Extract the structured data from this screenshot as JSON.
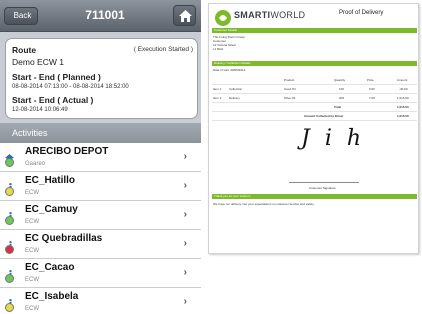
{
  "navbar": {
    "back_label": "Back",
    "title": "711001"
  },
  "route": {
    "label": "Route",
    "status": "( Execution Started )",
    "name": "Demo ECW 1",
    "planned_label": "Start - End ( Planned )",
    "planned_value": "08-08-2014 07:13:00 - 08-08-2014 18:52:00",
    "actual_label": "Start - End ( Actual )",
    "actual_value": "12-08-2014 10:06:49"
  },
  "activities": {
    "header": "Activities",
    "items": [
      {
        "title": "ARECIBO DEPOT",
        "subtitle": "Gaareo",
        "icon": "home-icon",
        "dot_color": "#69c95a"
      },
      {
        "title": "EC_Hatillo",
        "subtitle": "ECW",
        "icon": "person-icon",
        "dot_color": "#e8d84a"
      },
      {
        "title": "EC_Camuy",
        "subtitle": "ECW",
        "icon": "person-icon",
        "dot_color": "#69c95a"
      },
      {
        "title": "EC Quebradillas",
        "subtitle": "ECW",
        "icon": "person-icon",
        "dot_color": "#d9323a"
      },
      {
        "title": "EC_Cacao",
        "subtitle": "ECW",
        "icon": "person-icon",
        "dot_color": "#69c95a"
      },
      {
        "title": "EC_Isabela",
        "subtitle": "ECW",
        "icon": "person-icon",
        "dot_color": "#e8d84a"
      }
    ]
  },
  "document": {
    "brand_bold": "SMARTI",
    "brand_light": "WORLD",
    "title": "Proof of Delivery",
    "customer_details_label": "Customer Details",
    "customer_lines": [
      "The Living Room Group",
      "Customer",
      "10 Victoria Street",
      "LJ 8GG"
    ],
    "delivery_label": "Delivery / Collection Details",
    "date_line": "Date of visit: 20/06/2014",
    "table_headers": [
      "Product",
      "Quantity",
      "Price",
      "Amount"
    ],
    "rows": [
      [
        "Item 1",
        "Collection",
        "Used Oil",
        "100",
        "0.00",
        "-40.00"
      ],
      [
        "Item 1",
        "Delivery",
        "Olive Oil",
        "200",
        "7.00",
        "1,015.00"
      ]
    ],
    "total_label": "Total",
    "total_value": "1,015.00",
    "collected_label": "Amount Collected by Driver",
    "collected_value": "1,015.00",
    "signature_text": "J i h",
    "signature_caption": "Customer Signature",
    "thanks_label": "Thank you for your custom !",
    "thanks_line": "We hope our delivery met your expectations on customer service and safety"
  },
  "colors": {
    "accent_green": "#7dba2b",
    "navbar": "#6b727b"
  }
}
